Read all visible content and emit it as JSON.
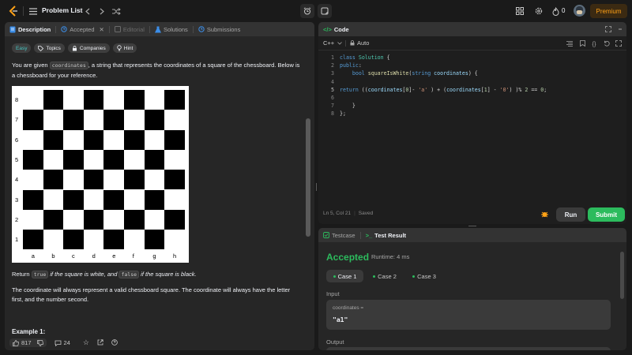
{
  "topbar": {
    "title": "Problem List",
    "streak_count": "0",
    "premium_label": "Premium"
  },
  "left_panel": {
    "tabs": [
      {
        "label": "Description"
      },
      {
        "label": "Accepted"
      },
      {
        "label": "Editorial"
      },
      {
        "label": "Solutions"
      },
      {
        "label": "Submissions"
      }
    ],
    "tags": [
      {
        "label": "Easy"
      },
      {
        "label": "Topics"
      },
      {
        "label": "Companies"
      },
      {
        "label": "Hint"
      }
    ],
    "intro_before": "You are given ",
    "intro_code": "coordinates",
    "intro_after": ", a string that represents the coordinates of a square of the chessboard. Below is a chessboard for your reference.",
    "board": {
      "ranks": [
        "8",
        "7",
        "6",
        "5",
        "4",
        "3",
        "2",
        "1"
      ],
      "files": [
        "a",
        "b",
        "c",
        "d",
        "e",
        "f",
        "g",
        "h"
      ]
    },
    "return_prefix": "Return ",
    "return_true": "true",
    "return_mid": " if the square is white, and ",
    "return_false": "false",
    "return_suffix": " if the square is black.",
    "guarantee": "The coordinate will always represent a valid chessboard square. The coordinate will always have the letter first, and the number second.",
    "example_title": "Example 1:",
    "likes": "817",
    "comments": "24"
  },
  "code_panel": {
    "title": "Code",
    "language": "C++",
    "mode": "Auto",
    "lines": [
      "1",
      "2",
      "3",
      "4",
      "5",
      "6",
      "7",
      "8"
    ],
    "status_pos": "Ln 5, Col 21",
    "status_saved": "Saved",
    "run_label": "Run",
    "submit_label": "Submit"
  },
  "result_panel": {
    "tabs": [
      {
        "label": "Testcase"
      },
      {
        "label": "Test Result"
      }
    ],
    "status": "Accepted",
    "runtime": "Runtime: 4 ms",
    "cases": [
      {
        "label": "Case 1"
      },
      {
        "label": "Case 2"
      },
      {
        "label": "Case 3"
      }
    ],
    "input_label": "Input",
    "input_var": "coordinates =",
    "input_value": "\"a1\"",
    "output_label": "Output"
  },
  "colors": {
    "accent_green": "#2cbb5d",
    "accepted_green": "#2cbb5d",
    "premium_orange": "#ffa116",
    "easy_teal": "#46c6c2"
  }
}
